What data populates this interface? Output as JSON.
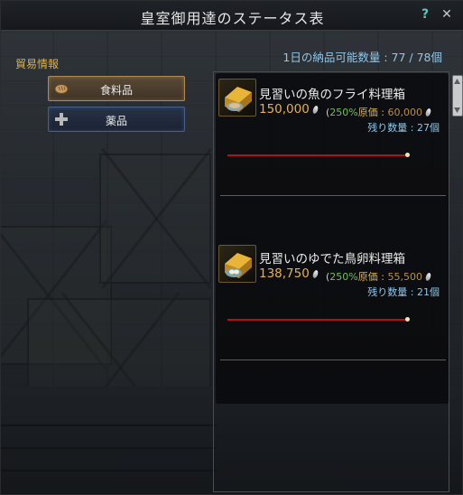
{
  "window": {
    "title": "皇室御用達のステータス表",
    "help_label": "?",
    "close_label": "✕"
  },
  "left": {
    "section_label": "貿易情報",
    "categories": [
      {
        "label": "食料品",
        "icon": "bread-icon",
        "selected": true
      },
      {
        "label": "薬品",
        "icon": "plus-cross-icon",
        "selected": false
      }
    ]
  },
  "right": {
    "quota": "1日の納品可能数量 : 77 / 78個",
    "items": [
      {
        "name": "見習いの魚のフライ料理箱",
        "icon": "fried-fish-box-icon",
        "price": "150,000",
        "percent": "250%",
        "paren_open": "(",
        "original_label": "原価 : ",
        "original_value": "60,000",
        "remaining": "残り数量 : 27個",
        "slider_value": 1.0
      },
      {
        "name": "見習いのゆでた鳥卵料理箱",
        "icon": "boiled-egg-box-icon",
        "price": "138,750",
        "percent": "250%",
        "paren_open": "(",
        "original_label": "原価 : ",
        "original_value": "55,500",
        "remaining": "残り数量 : 21個",
        "slider_value": 1.0
      }
    ]
  },
  "colors": {
    "accent_gold": "#e0b040",
    "price_gold": "#e6b14a",
    "info_blue": "#8fc7e8",
    "percent_green": "#6fbf5a",
    "slider_red": "#b0141a"
  }
}
